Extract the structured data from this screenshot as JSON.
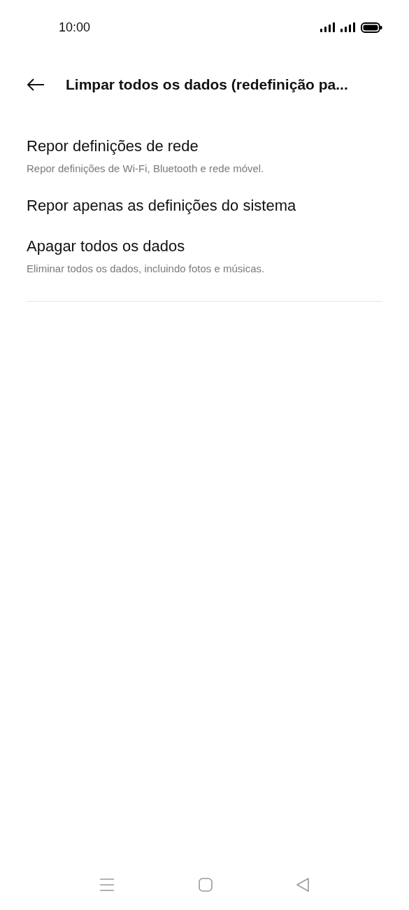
{
  "status_bar": {
    "time": "10:00"
  },
  "header": {
    "title": "Limpar todos os dados (redefinição pa..."
  },
  "items": [
    {
      "title": "Repor definições de rede",
      "subtitle": "Repor definições de Wi-Fi, Bluetooth e rede móvel."
    },
    {
      "title": "Repor apenas as definições do sistema"
    },
    {
      "title": "Apagar todos os dados",
      "subtitle": "Eliminar todos os dados, incluindo fotos e músicas."
    }
  ]
}
